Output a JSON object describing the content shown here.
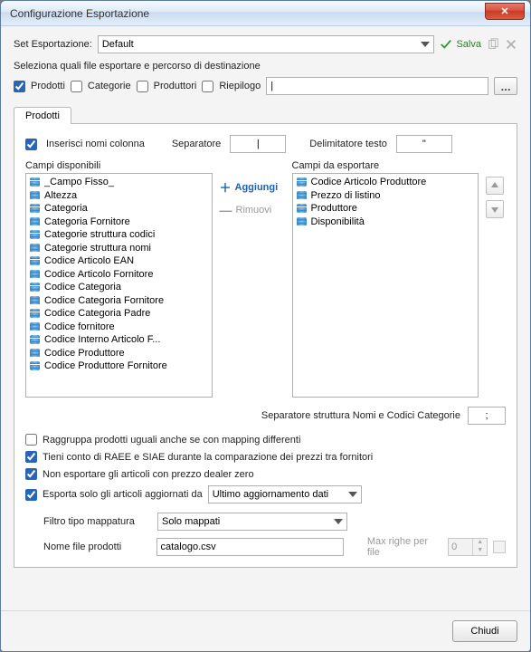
{
  "window": {
    "title": "Configurazione Esportazione"
  },
  "setRow": {
    "label": "Set Esportazione:",
    "selected": "Default",
    "save": "Salva"
  },
  "selectLine": "Seleziona quali file esportare e percorso di destinazione",
  "fileChecks": {
    "prodotti": "Prodotti",
    "categorie": "Categorie",
    "produttori": "Produttori",
    "riepilogo": "Riepilogo"
  },
  "path": {
    "value": "|",
    "browse": "..."
  },
  "tabs": {
    "prodotti": "Prodotti"
  },
  "panel": {
    "insertNames": "Inserisci nomi colonna",
    "separatorLbl": "Separatore",
    "separatorVal": "|",
    "textDelimLbl": "Delimitatore testo",
    "textDelimVal": "\"",
    "availHead": "Campi disponibili",
    "exportHead": "Campi da esportare",
    "add": "Aggiungi",
    "remove": "Rimuovi",
    "catSepLbl": "Separatore struttura Nomi e Codici Categorie",
    "catSepVal": ";"
  },
  "available": [
    "_Campo Fisso_",
    "Altezza",
    "Categoria",
    "Categoria Fornitore",
    "Categorie struttura codici",
    "Categorie struttura nomi",
    "Codice Articolo EAN",
    "Codice Articolo Fornitore",
    "Codice Categoria",
    "Codice Categoria Fornitore",
    "Codice Categoria Padre",
    "Codice fornitore",
    "Codice Interno Articolo F...",
    "Codice Produttore",
    "Codice Produttore Fornitore"
  ],
  "toexport": [
    "Codice Articolo Produttore",
    "Prezzo di listino",
    "Produttore",
    "Disponibilità"
  ],
  "opts": {
    "group": "Raggruppa prodotti uguali anche se con mapping differenti",
    "raee": "Tieni conto di RAEE e SIAE durante la comparazione dei prezzi tra fornitori",
    "noDealerZero": "Non esportare gli articoli con prezzo dealer zero",
    "onlyUpdated": "Esporta solo gli articoli aggiornati da",
    "updatedSel": "Ultimo aggiornamento dati",
    "mapFilterLbl": "Filtro tipo mappatura",
    "mapFilterSel": "Solo mappati",
    "fileNameLbl": "Nome file prodotti",
    "fileNameVal": "catalogo.csv",
    "maxRowsLbl": "Max righe per file",
    "maxRowsVal": "0"
  },
  "footer": {
    "close": "Chiudi"
  }
}
